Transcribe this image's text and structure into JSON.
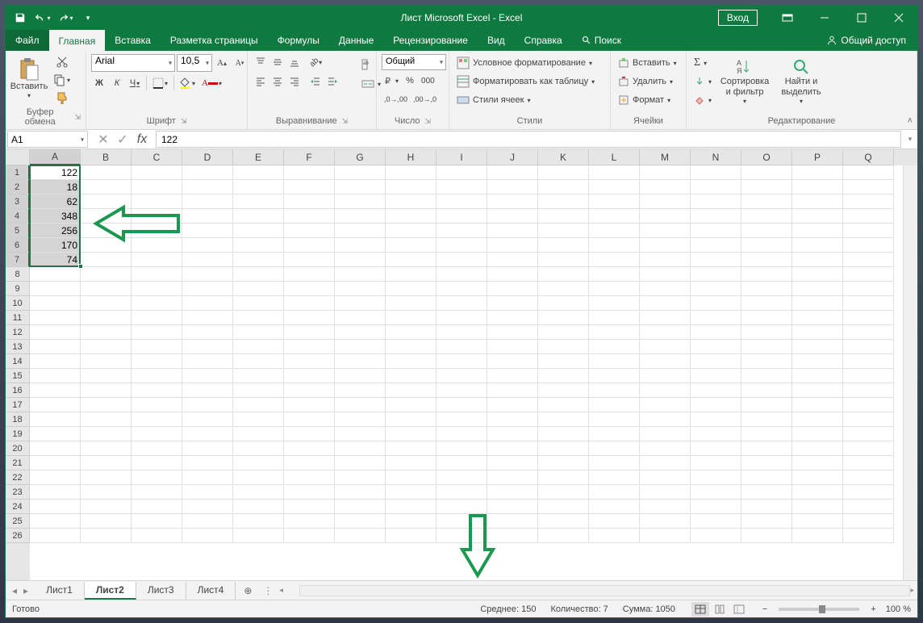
{
  "title": "Лист Microsoft Excel  -  Excel",
  "signin": "Вход",
  "menu": {
    "file": "Файл",
    "home": "Главная",
    "insert": "Вставка",
    "layout": "Разметка страницы",
    "formulas": "Формулы",
    "data": "Данные",
    "review": "Рецензирование",
    "view": "Вид",
    "help": "Справка",
    "search": "Поиск",
    "share": "Общий доступ"
  },
  "ribbon": {
    "paste": "Вставить",
    "clipboard": "Буфер обмена",
    "font": "Шрифт",
    "font_name": "Arial",
    "font_size": "10,5",
    "bold": "Ж",
    "italic": "К",
    "underline": "Ч",
    "alignment": "Выравнивание",
    "number": "Число",
    "number_format": "Общий",
    "styles": "Стили",
    "cond_format": "Условное форматирование",
    "format_table": "Форматировать как таблицу",
    "cell_styles": "Стили ячеек",
    "cells": "Ячейки",
    "insert_cells": "Вставить",
    "delete_cells": "Удалить",
    "format_cells": "Формат",
    "editing": "Редактирование",
    "sort_filter": "Сортировка и фильтр",
    "find_select": "Найти и выделить"
  },
  "namebox": "A1",
  "formula": "122",
  "columns": [
    "A",
    "B",
    "C",
    "D",
    "E",
    "F",
    "G",
    "H",
    "I",
    "J",
    "K",
    "L",
    "M",
    "N",
    "O",
    "P",
    "Q"
  ],
  "data_values": [
    "122",
    "18",
    "62",
    "348",
    "256",
    "170",
    "74"
  ],
  "sheets": [
    "Лист1",
    "Лист2",
    "Лист3",
    "Лист4"
  ],
  "active_sheet": 1,
  "status": {
    "ready": "Готово",
    "avg": "Среднее: 150",
    "count": "Количество: 7",
    "sum": "Сумма: 1050",
    "zoom": "100 %"
  }
}
